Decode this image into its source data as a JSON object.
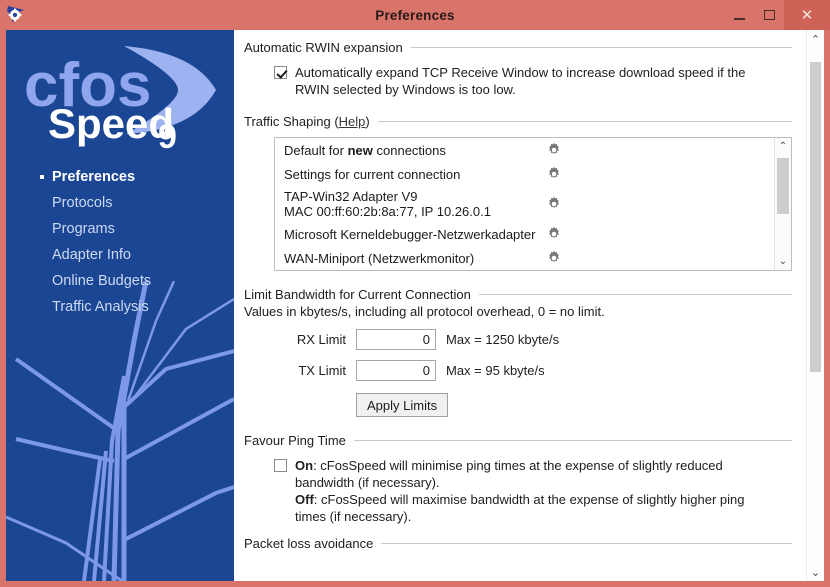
{
  "window": {
    "title": "Preferences",
    "app_icon": "cfosspeed-gear-icon",
    "controls": {
      "minimize": "minimize-icon",
      "maximize": "maximize-icon",
      "close": "✕"
    },
    "accent_color": "#d9746a",
    "sidebar_color": "#1a4693"
  },
  "sidebar": {
    "logo": {
      "part1": "cfos",
      "part2": "Speed",
      "part3": "9"
    },
    "items": [
      {
        "label": "Preferences",
        "active": true
      },
      {
        "label": "Protocols",
        "active": false
      },
      {
        "label": "Programs",
        "active": false
      },
      {
        "label": "Adapter Info",
        "active": false
      },
      {
        "label": "Online Budgets",
        "active": false
      },
      {
        "label": "Traffic Analysis",
        "active": false
      }
    ]
  },
  "main": {
    "rwin": {
      "header": "Automatic RWIN expansion",
      "checkbox_checked": true,
      "checkbox_label": "Automatically expand TCP Receive Window to increase download speed if the RWIN selected by Windows is too low."
    },
    "traffic_shaping": {
      "header": "Traffic Shaping (",
      "help_link": "Help",
      "header_close": ")",
      "items": [
        {
          "text_before": "Default for ",
          "bold": "new",
          "text_after": " connections",
          "sub": ""
        },
        {
          "text_before": "Settings for current connection",
          "bold": "",
          "text_after": "",
          "sub": ""
        },
        {
          "text_before": "TAP-Win32 Adapter V9",
          "bold": "",
          "text_after": "",
          "sub": "MAC 00:ff:60:2b:8a:77, IP 10.26.0.1"
        },
        {
          "text_before": "Microsoft Kerneldebugger-Netzwerkadapter",
          "bold": "",
          "text_after": "",
          "sub": ""
        },
        {
          "text_before": "WAN-Miniport (Netzwerkmonitor)",
          "bold": "",
          "text_after": "",
          "sub": ""
        }
      ]
    },
    "limit": {
      "header": "Limit Bandwidth for Current Connection",
      "note": "Values in kbytes/s, including all protocol overhead, 0 = no limit.",
      "rx_label": "RX Limit",
      "rx_value": "0",
      "rx_max": "Max = 1250 kbyte/s",
      "tx_label": "TX Limit",
      "tx_value": "0",
      "tx_max": "Max = 95 kbyte/s",
      "apply_button": "Apply Limits"
    },
    "ping": {
      "header": "Favour Ping Time",
      "checkbox_checked": false,
      "on_label": "On",
      "on_text": ": cFosSpeed will minimise ping times at the expense of slightly reduced bandwidth (if necessary).",
      "off_label": "Off",
      "off_text": ": cFosSpeed will maximise bandwidth at the expense of slightly higher ping times (if necessary)."
    },
    "packet_loss": {
      "header": "Packet loss avoidance"
    }
  },
  "scrollbars": {
    "up_arrow": "⌃",
    "down_arrow": "⌄"
  }
}
